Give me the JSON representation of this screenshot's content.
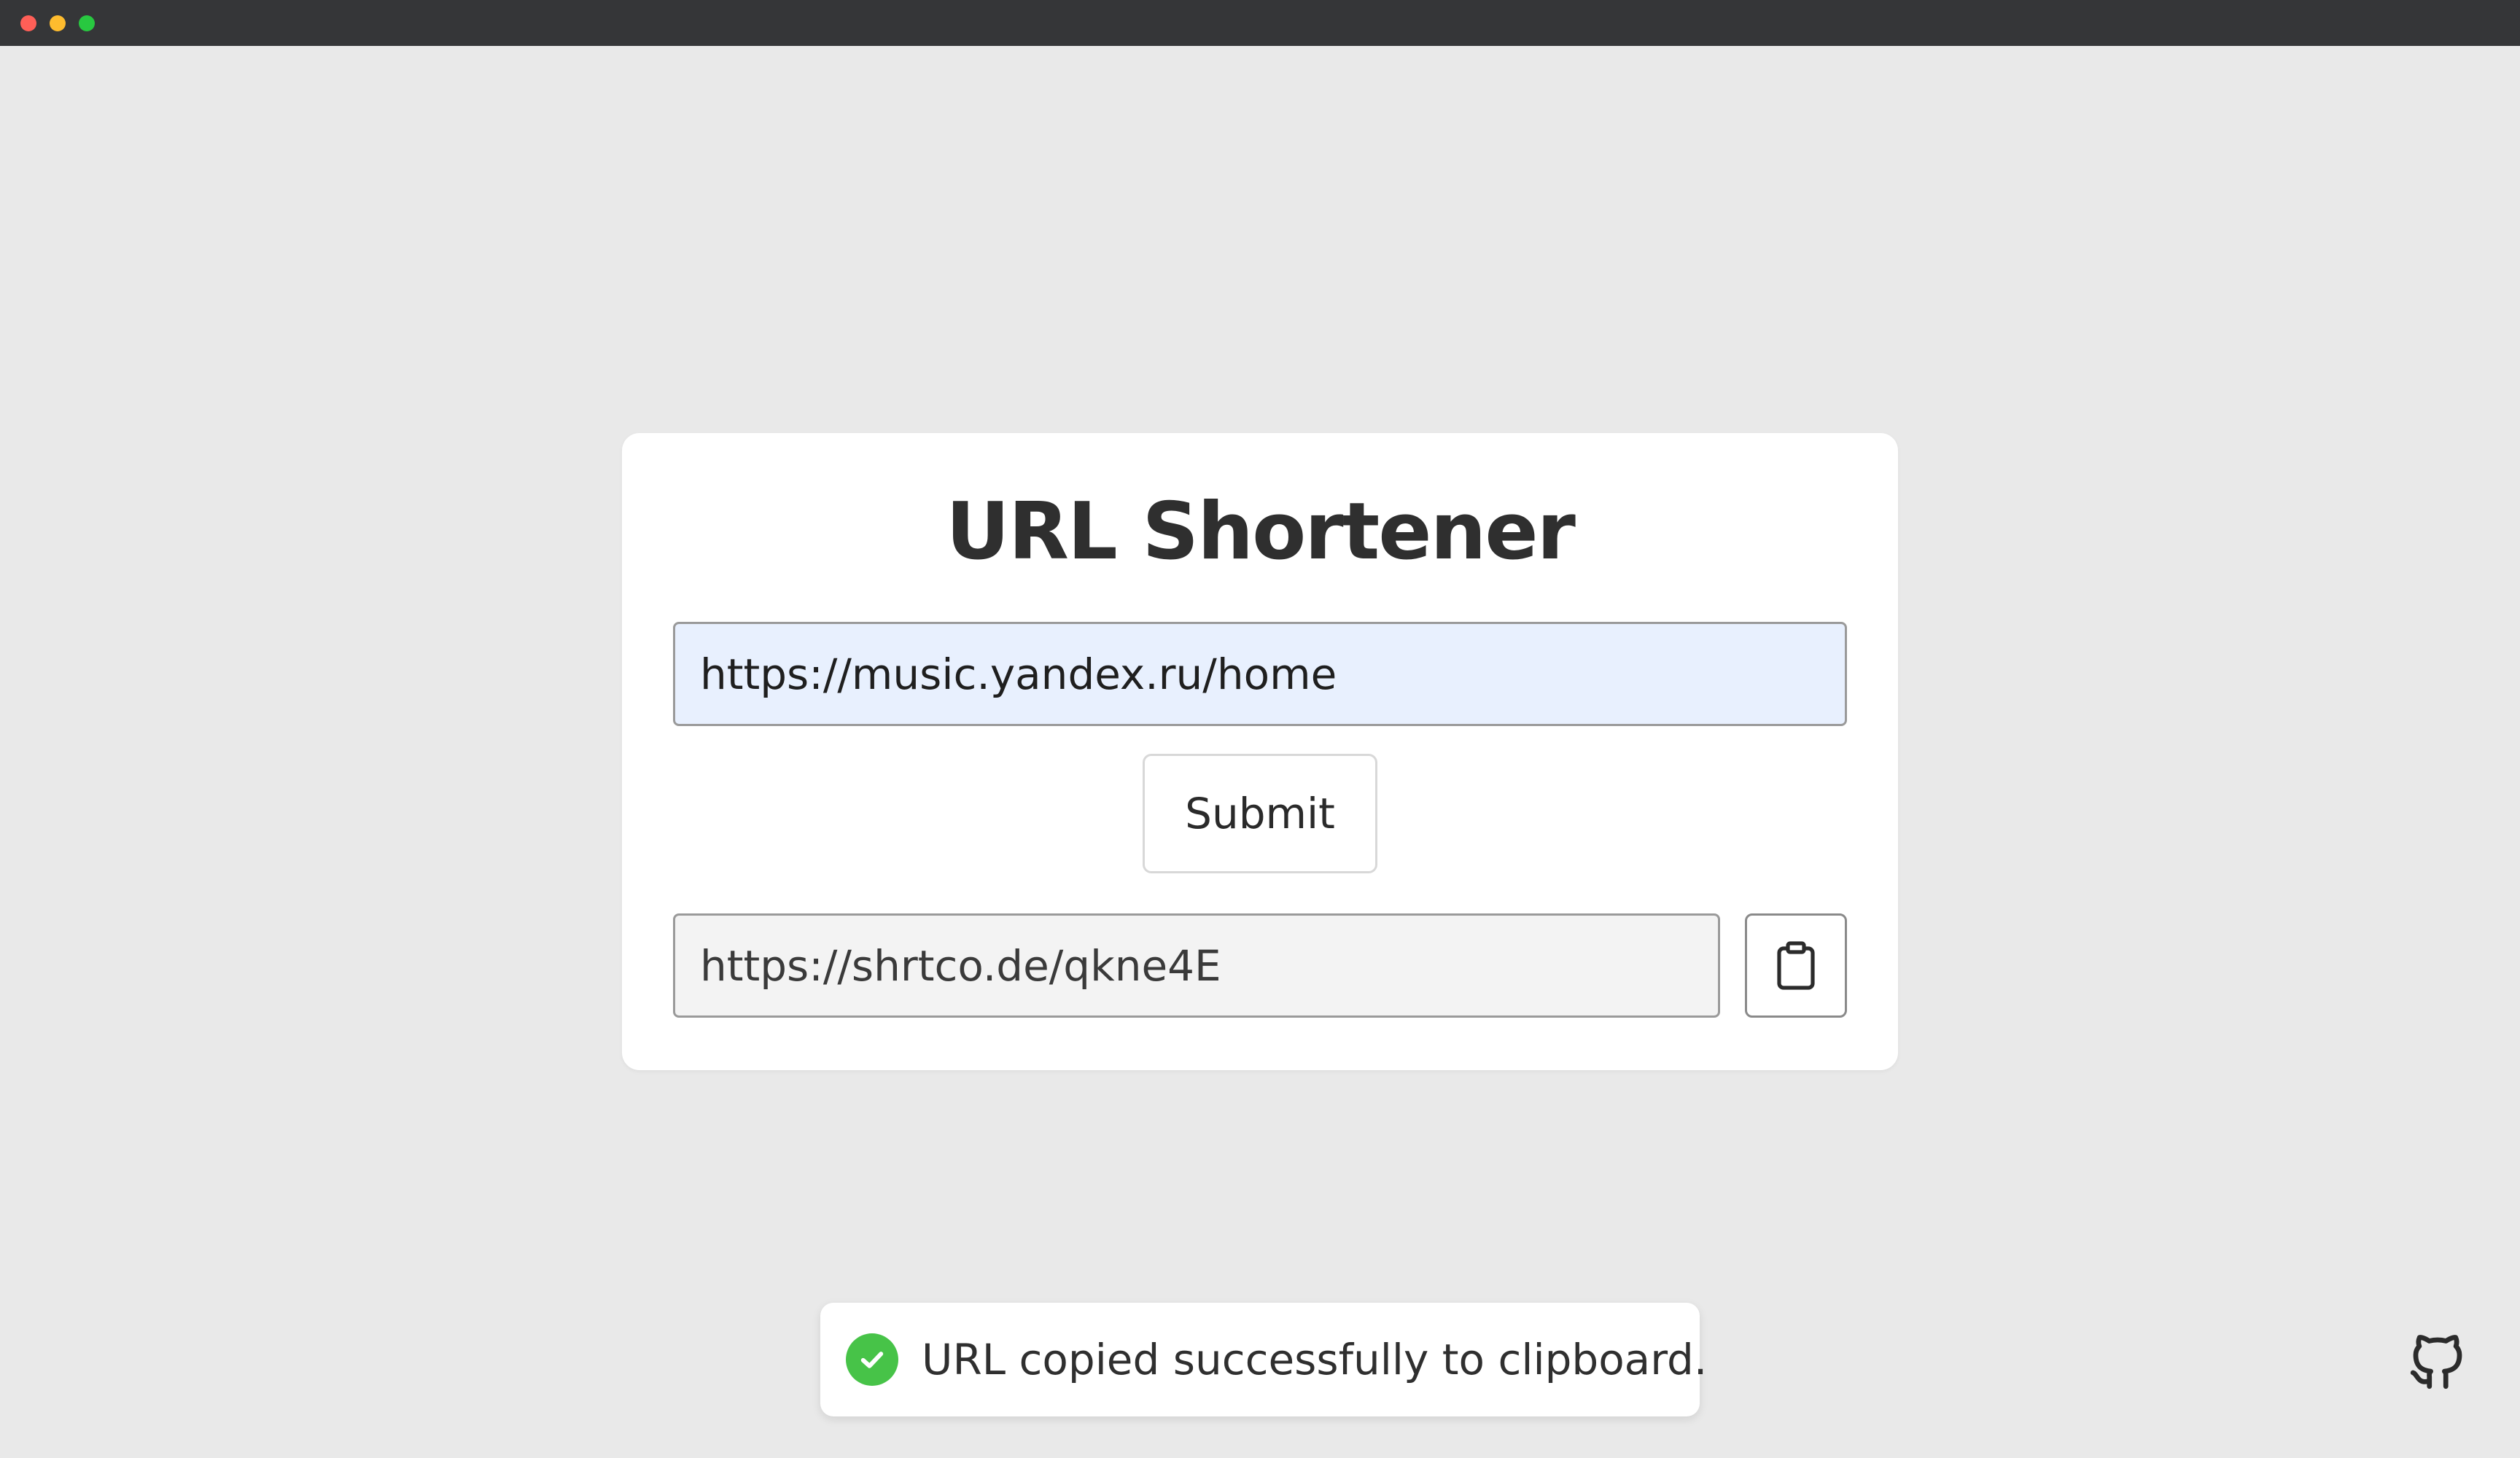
{
  "window": {
    "titlebar_color": "#353638",
    "controls": [
      "close",
      "minimize",
      "maximize"
    ]
  },
  "app": {
    "title": "URL Shortener"
  },
  "form": {
    "url_value": "https://music.yandex.ru/home",
    "submit_label": "Submit"
  },
  "result": {
    "short_url": "https://shrtco.de/qkne4E",
    "copy_icon": "clipboard-icon"
  },
  "toast": {
    "message": "URL copied successfully to clipboard.",
    "icon": "check-circle-icon",
    "status_color": "#47c348"
  },
  "footer": {
    "icon": "github-icon"
  }
}
